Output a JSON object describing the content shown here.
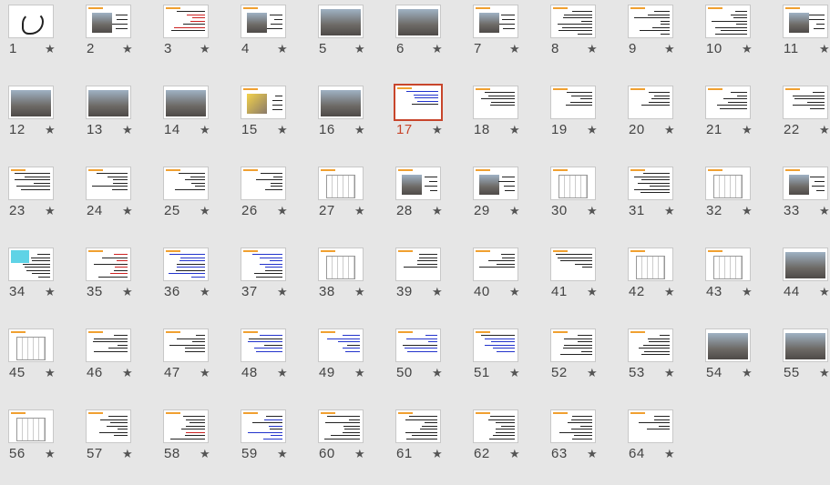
{
  "star_icon": "★",
  "selected_slide": 17,
  "slides": [
    {
      "number": "1",
      "kind": "logo"
    },
    {
      "number": "2",
      "kind": "photo-text"
    },
    {
      "number": "3",
      "kind": "text-red"
    },
    {
      "number": "4",
      "kind": "photo-text"
    },
    {
      "number": "5",
      "kind": "photo"
    },
    {
      "number": "6",
      "kind": "photo"
    },
    {
      "number": "7",
      "kind": "photo-text"
    },
    {
      "number": "8",
      "kind": "text"
    },
    {
      "number": "9",
      "kind": "text"
    },
    {
      "number": "10",
      "kind": "text"
    },
    {
      "number": "11",
      "kind": "photo-text"
    },
    {
      "number": "12",
      "kind": "photo"
    },
    {
      "number": "13",
      "kind": "photo"
    },
    {
      "number": "14",
      "kind": "photo"
    },
    {
      "number": "15",
      "kind": "photo-yellow"
    },
    {
      "number": "16",
      "kind": "photo"
    },
    {
      "number": "17",
      "kind": "text-blue"
    },
    {
      "number": "18",
      "kind": "text"
    },
    {
      "number": "19",
      "kind": "text"
    },
    {
      "number": "20",
      "kind": "text"
    },
    {
      "number": "21",
      "kind": "text"
    },
    {
      "number": "22",
      "kind": "text"
    },
    {
      "number": "23",
      "kind": "text"
    },
    {
      "number": "24",
      "kind": "text"
    },
    {
      "number": "25",
      "kind": "text"
    },
    {
      "number": "26",
      "kind": "text"
    },
    {
      "number": "27",
      "kind": "diagram"
    },
    {
      "number": "28",
      "kind": "photo-text"
    },
    {
      "number": "29",
      "kind": "photo-text"
    },
    {
      "number": "30",
      "kind": "diagram"
    },
    {
      "number": "31",
      "kind": "text"
    },
    {
      "number": "32",
      "kind": "diagram"
    },
    {
      "number": "33",
      "kind": "photo-text"
    },
    {
      "number": "34",
      "kind": "text-cyan"
    },
    {
      "number": "35",
      "kind": "text-red"
    },
    {
      "number": "36",
      "kind": "text-blue"
    },
    {
      "number": "37",
      "kind": "text-blue"
    },
    {
      "number": "38",
      "kind": "diagram"
    },
    {
      "number": "39",
      "kind": "text"
    },
    {
      "number": "40",
      "kind": "text"
    },
    {
      "number": "41",
      "kind": "text"
    },
    {
      "number": "42",
      "kind": "diagram"
    },
    {
      "number": "43",
      "kind": "diagram"
    },
    {
      "number": "44",
      "kind": "photo"
    },
    {
      "number": "45",
      "kind": "diagram"
    },
    {
      "number": "46",
      "kind": "text"
    },
    {
      "number": "47",
      "kind": "text"
    },
    {
      "number": "48",
      "kind": "text-blue"
    },
    {
      "number": "49",
      "kind": "text-blue"
    },
    {
      "number": "50",
      "kind": "text-blue"
    },
    {
      "number": "51",
      "kind": "text-blue"
    },
    {
      "number": "52",
      "kind": "text"
    },
    {
      "number": "53",
      "kind": "text"
    },
    {
      "number": "54",
      "kind": "photo"
    },
    {
      "number": "55",
      "kind": "photo"
    },
    {
      "number": "56",
      "kind": "diagram"
    },
    {
      "number": "57",
      "kind": "text"
    },
    {
      "number": "58",
      "kind": "text-red"
    },
    {
      "number": "59",
      "kind": "text-blue"
    },
    {
      "number": "60",
      "kind": "text"
    },
    {
      "number": "61",
      "kind": "text"
    },
    {
      "number": "62",
      "kind": "text"
    },
    {
      "number": "63",
      "kind": "text"
    },
    {
      "number": "64",
      "kind": "text"
    }
  ]
}
